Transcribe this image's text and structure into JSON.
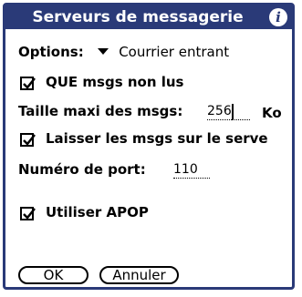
{
  "window": {
    "title": "Serveurs de messagerie",
    "info_icon_glyph": "i"
  },
  "options": {
    "label": "Options:",
    "selected_value": "Courrier entrant"
  },
  "unread_only": {
    "label": "QUE msgs non lus",
    "checked": true
  },
  "max_size": {
    "label": "Taille maxi des msgs:",
    "value": "256",
    "unit": "Ko"
  },
  "leave_on_server": {
    "label": "Laisser les msgs sur le serve",
    "checked": true
  },
  "port": {
    "label": "Numéro de port:",
    "value": "110"
  },
  "apop": {
    "label": "Utiliser APOP",
    "checked": true
  },
  "buttons": {
    "ok": "OK",
    "cancel": "Annuler"
  },
  "colors": {
    "title_bar": "#2a3a78",
    "background": "#ffffff",
    "text": "#000000"
  }
}
